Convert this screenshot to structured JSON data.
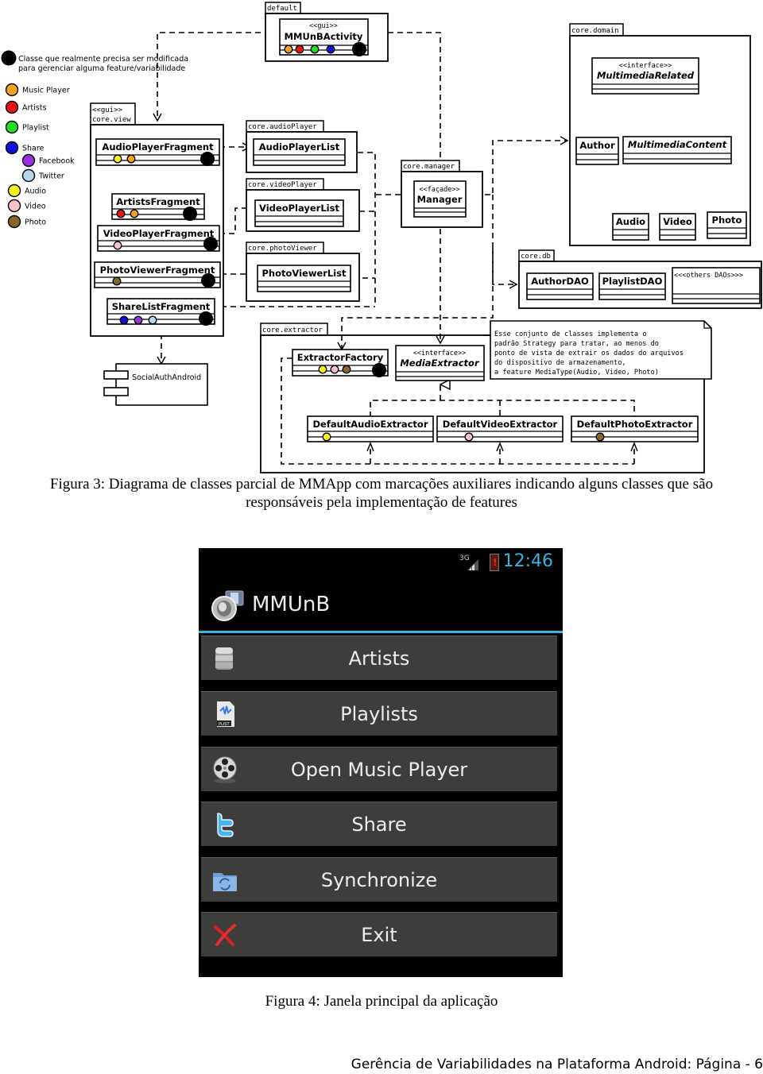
{
  "figure3": {
    "caption_line1": "Figura 3: Diagrama de classes parcial de MMApp com marcações auxiliares indicando alguns classes que são",
    "caption_line2": "responsáveis pela implementação de features",
    "legend": {
      "modified_line1": "Classe que realmente precisa ser modificada",
      "modified_line2": "para gerenciar alguma feature/variabilidade",
      "items": [
        {
          "label": "Music Player",
          "color": "#f5a020"
        },
        {
          "label": "Artists",
          "color": "#e81414"
        },
        {
          "label": "Playlist",
          "color": "#22dd22"
        },
        {
          "label": "Share",
          "color": "#1010dd"
        },
        {
          "label": "Facebook",
          "color": "#9932dd"
        },
        {
          "label": "Twitter",
          "color": "#b4d8ea"
        },
        {
          "label": "Audio",
          "color": "#f5f020"
        },
        {
          "label": "Video",
          "color": "#f8c0c8"
        },
        {
          "label": "Photo",
          "color": "#86662a"
        }
      ]
    },
    "packages": {
      "default": "default",
      "view_stereo": "<<gui>>",
      "view": "core.view",
      "audioPlayer": "core.audioPlayer",
      "videoPlayer": "core.videoPlayer",
      "photoViewer": "core.photoViewer",
      "manager": "core.manager",
      "domain": "core.domain",
      "db": "core.db",
      "extractor": "core.extractor"
    },
    "classes": {
      "mmunb_stereo": "<<gui>>",
      "mmunb": "MMUnBActivity",
      "audioPlayerFragment": "AudioPlayerFragment",
      "artistsFragment": "ArtistsFragment",
      "videoPlayerFragment": "VideoPlayerFragment",
      "photoViewerFragment": "PhotoViewerFragment",
      "shareListFragment": "ShareListFragment",
      "audioPlayerList": "AudioPlayerList",
      "videoPlayerList": "VideoPlayerList",
      "photoViewerList": "PhotoViewerList",
      "manager_stereo": "<<façade>>",
      "manager": "Manager",
      "multimedia_stereo": "<<interface>>",
      "multimediaRelated": "MultimediaRelated",
      "author": "Author",
      "multimediaContent": "MultimediaContent",
      "audio": "Audio",
      "video": "Video",
      "photo": "Photo",
      "authorDAO": "AuthorDAO",
      "playlistDAO": "PlaylistDAO",
      "othersDAOs": "<<<others DAOs>>>",
      "extractorFactory": "ExtractorFactory",
      "mediaExtractor_stereo": "<<interface>>",
      "mediaExtractor": "MediaExtractor",
      "defaultAudioExtractor": "DefaultAudioExtractor",
      "defaultVideoExtractor": "DefaultVideoExtractor",
      "defaultPhotoExtractor": "DefaultPhotoExtractor",
      "socialAuth": "SocialAuthAndroid"
    },
    "note": [
      "Esse conjunto de classes implementa o",
      "padrão Strategy para tratar, ao menos do",
      "ponto de vista de extrair os dados do arquivos",
      "do dispositivo de armazenamento,",
      "a feature MediaType(Audio, Video, Photo)"
    ]
  },
  "figure4": {
    "caption": "Figura 4: Janela principal da aplicação",
    "status_bar": {
      "network": "3G",
      "time": "12:46"
    },
    "app_title": "MMUnB",
    "accent_color": "#33b5e5",
    "menu": [
      {
        "label": "Artists",
        "icon": "database-icon"
      },
      {
        "label": "Playlists",
        "icon": "playlist-file-icon"
      },
      {
        "label": "Open Music Player",
        "icon": "film-reel-icon"
      },
      {
        "label": "Share",
        "icon": "twitter-icon"
      },
      {
        "label": "Synchronize",
        "icon": "sync-folder-icon"
      },
      {
        "label": "Exit",
        "icon": "exit-x-icon"
      }
    ]
  },
  "footer": "Gerência de Variabilidades na Plataforma Android: Página - 6"
}
